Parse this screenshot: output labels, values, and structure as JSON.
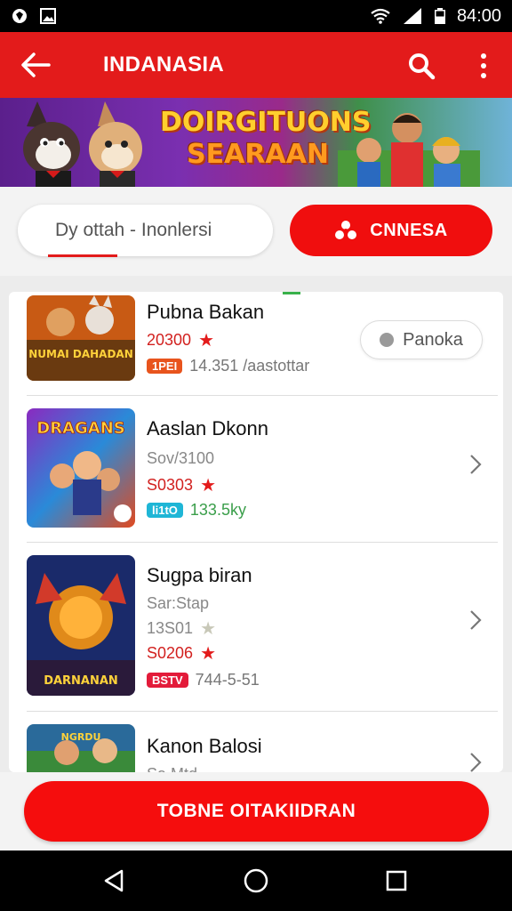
{
  "status_bar": {
    "time": "84:00"
  },
  "app_bar": {
    "title": "INDANASIA"
  },
  "banner": {
    "title_line1": "DOIRGITUONS",
    "title_line2": "SEARAAN"
  },
  "filter": {
    "search_placeholder": "Dy ottah - Inonlersi",
    "filter_button_label": "CNNESA"
  },
  "list": {
    "items": [
      {
        "title": "Pubna Bakan",
        "rating": "20300",
        "tag": "1PEI",
        "tag_color": "#e8541d",
        "meta": "14.351 /aastottar",
        "action_label": "Panoka",
        "thumb_text": "NUMAI DAHADAN"
      },
      {
        "title": "Aaslan Dkonn",
        "subtitle": "Sov/3100",
        "rating": "S0303",
        "tag": "li1tO",
        "tag_color": "#1fb6d6",
        "meta": "133.5ky",
        "thumb_text": "DRAGANS"
      },
      {
        "title": "Sugpa biran",
        "subtitle": "Sar:Stap",
        "secondary_rating": "13S01",
        "rating": "S0206",
        "tag": "BSTV",
        "tag_color": "#e31b3a",
        "meta": "744-5-51",
        "thumb_text": "DARNANAN"
      },
      {
        "title": "Kanon Balosi",
        "subtitle": "Sa Mtd",
        "thumb_text": "NGRDU"
      }
    ]
  },
  "cta": {
    "label": "TOBNE OITAKIIDRAN"
  },
  "colors": {
    "brand_red": "#e31b1b",
    "status_black": "#000000"
  },
  "icons": [
    "shield-icon",
    "image-icon",
    "wifi-icon",
    "signal-icon",
    "battery-icon",
    "back-arrow-icon",
    "search-icon",
    "more-vert-icon",
    "filter-icon",
    "chevron-right-icon",
    "nav-back-icon",
    "nav-home-icon",
    "nav-recents-icon"
  ]
}
